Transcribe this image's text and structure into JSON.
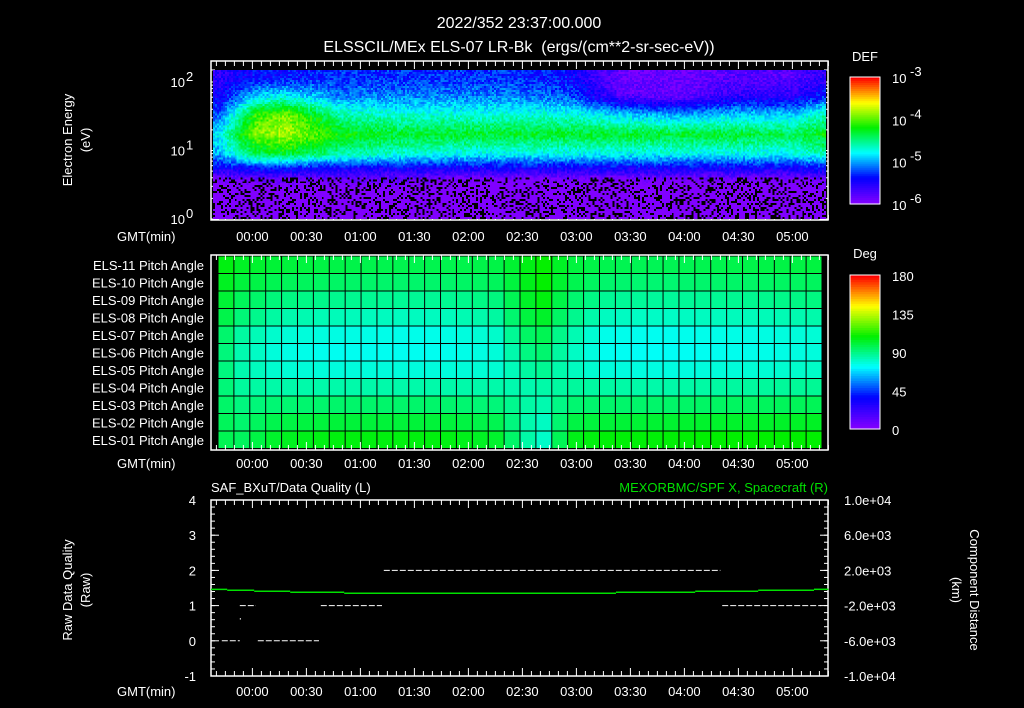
{
  "header": {
    "timestamp": "2022/352 23:37:00.000",
    "subtitle": "ELSSCIL/MEx ELS-07 LR-Bk  (ergs/(cm**2-sr-sec-eV))"
  },
  "colors": {
    "background": "#000000",
    "axis": "#ffffff",
    "spacecraft_line": "#00e000",
    "quality_line": "#ffffff"
  },
  "time_axis": {
    "label": "GMT(min)",
    "start_min": -23,
    "end_min": 320,
    "ticks": [
      {
        "min": 0,
        "label": "00:00"
      },
      {
        "min": 30,
        "label": "00:30"
      },
      {
        "min": 60,
        "label": "01:00"
      },
      {
        "min": 90,
        "label": "01:30"
      },
      {
        "min": 120,
        "label": "02:00"
      },
      {
        "min": 150,
        "label": "02:30"
      },
      {
        "min": 180,
        "label": "03:00"
      },
      {
        "min": 210,
        "label": "03:30"
      },
      {
        "min": 240,
        "label": "04:00"
      },
      {
        "min": 270,
        "label": "04:30"
      },
      {
        "min": 300,
        "label": "05:00"
      }
    ]
  },
  "chart_data": [
    {
      "type": "heatmap",
      "title": "ELSSCIL/MEx ELS-07 LR-Bk",
      "ylabel": "Electron Energy",
      "yunits": "(eV)",
      "yscale": "log",
      "ylim": [
        1,
        200
      ],
      "yticks": [
        {
          "value": 1,
          "base": "10",
          "exp": "0"
        },
        {
          "value": 10,
          "base": "10",
          "exp": "1"
        },
        {
          "value": 100,
          "base": "10",
          "exp": "2"
        }
      ],
      "colorbar": {
        "label": "DEF",
        "scale": "log",
        "range": [
          1e-06,
          0.001
        ],
        "ticks": [
          {
            "base": "10",
            "exp": "-3"
          },
          {
            "base": "10",
            "exp": "-4"
          },
          {
            "base": "10",
            "exp": "-5"
          },
          {
            "base": "10",
            "exp": "-6"
          }
        ]
      },
      "times_min": [
        -20,
        0,
        15,
        45,
        75,
        105,
        135,
        165,
        195,
        225,
        255,
        285,
        305,
        318
      ],
      "energies_eV": [
        1.5,
        2.5,
        4,
        6,
        10,
        20,
        40,
        80,
        150
      ],
      "log10_def": [
        [
          -6.3,
          -6.3,
          -6.3,
          -6.3,
          -6.3,
          -6.4,
          -6.4,
          -6.4,
          -6.4,
          -6.4,
          -6.4,
          -6.4,
          -6.3,
          -6.2
        ],
        [
          -6.2,
          -6.2,
          -6.2,
          -6.2,
          -6.2,
          -6.3,
          -6.3,
          -6.3,
          -6.3,
          -6.3,
          -6.3,
          -6.3,
          -6.2,
          -6.1
        ],
        [
          -6.0,
          -5.9,
          -5.9,
          -5.9,
          -5.9,
          -6.0,
          -6.0,
          -6.0,
          -6.0,
          -6.0,
          -6.0,
          -6.0,
          -5.9,
          -5.8
        ],
        [
          -5.5,
          -5.4,
          -5.4,
          -5.5,
          -5.5,
          -5.5,
          -5.5,
          -5.5,
          -5.5,
          -5.5,
          -5.5,
          -5.5,
          -5.4,
          -5.2
        ],
        [
          -5.0,
          -4.4,
          -4.3,
          -4.6,
          -4.7,
          -4.8,
          -4.8,
          -4.8,
          -4.8,
          -4.8,
          -4.8,
          -4.8,
          -4.6,
          -4.2
        ],
        [
          -4.8,
          -3.9,
          -3.8,
          -4.2,
          -4.3,
          -4.3,
          -4.3,
          -4.3,
          -4.3,
          -4.3,
          -4.3,
          -4.4,
          -4.2,
          -3.6
        ],
        [
          -5.2,
          -4.1,
          -3.9,
          -4.6,
          -4.7,
          -4.7,
          -4.7,
          -4.7,
          -4.9,
          -5.0,
          -4.9,
          -4.9,
          -4.6,
          -3.6
        ],
        [
          -5.5,
          -4.9,
          -4.8,
          -5.1,
          -5.1,
          -5.1,
          -5.1,
          -5.2,
          -5.8,
          -5.9,
          -5.6,
          -5.6,
          -5.3,
          -4.4
        ],
        [
          -5.6,
          -5.4,
          -5.4,
          -5.3,
          -5.3,
          -5.3,
          -5.3,
          -5.4,
          -5.9,
          -5.9,
          -5.8,
          -5.8,
          -5.6,
          -5.0
        ]
      ]
    },
    {
      "type": "heatmap",
      "title": "Pitch Angle",
      "colorbar": {
        "label": "Deg",
        "range": [
          0,
          180
        ],
        "ticks": [
          "180",
          "135",
          "90",
          "45",
          "0"
        ]
      },
      "times_min": [
        -20,
        -8,
        15,
        45,
        75,
        105,
        135,
        150,
        160,
        175,
        195,
        225,
        255,
        285,
        315
      ],
      "rows": [
        {
          "label": "ELS-11 Pitch Angle",
          "values": [
            108,
            103,
            100,
            98,
            97,
            97,
            98,
            103,
            110,
            100,
            97,
            96,
            97,
            98,
            99
          ]
        },
        {
          "label": "ELS-10 Pitch Angle",
          "values": [
            106,
            100,
            96,
            94,
            93,
            93,
            95,
            102,
            110,
            98,
            93,
            92,
            93,
            94,
            95
          ]
        },
        {
          "label": "ELS-09 Pitch Angle",
          "values": [
            104,
            96,
            90,
            88,
            87,
            87,
            90,
            100,
            108,
            94,
            87,
            86,
            87,
            88,
            90
          ]
        },
        {
          "label": "ELS-08 Pitch Angle",
          "values": [
            102,
            92,
            84,
            82,
            81,
            81,
            85,
            97,
            104,
            90,
            81,
            80,
            81,
            82,
            84
          ]
        },
        {
          "label": "ELS-07 Pitch Angle",
          "values": [
            98,
            86,
            78,
            76,
            75,
            75,
            79,
            92,
            98,
            85,
            75,
            74,
            75,
            76,
            78
          ]
        },
        {
          "label": "ELS-06 Pitch Angle",
          "values": [
            96,
            84,
            76,
            74,
            74,
            74,
            77,
            88,
            94,
            82,
            74,
            73,
            74,
            75,
            77
          ]
        },
        {
          "label": "ELS-05 Pitch Angle",
          "values": [
            95,
            84,
            78,
            77,
            77,
            77,
            78,
            84,
            88,
            82,
            77,
            76,
            77,
            78,
            80
          ]
        },
        {
          "label": "ELS-04 Pitch Angle",
          "values": [
            95,
            86,
            84,
            84,
            84,
            84,
            84,
            83,
            84,
            86,
            85,
            84,
            85,
            86,
            87
          ]
        },
        {
          "label": "ELS-03 Pitch Angle",
          "values": [
            96,
            90,
            92,
            93,
            93,
            93,
            91,
            86,
            82,
            92,
            93,
            93,
            94,
            95,
            96
          ]
        },
        {
          "label": "ELS-02 Pitch Angle",
          "values": [
            98,
            92,
            98,
            100,
            100,
            100,
            97,
            86,
            78,
            98,
            100,
            101,
            102,
            102,
            103
          ]
        },
        {
          "label": "ELS-01 Pitch Angle",
          "values": [
            98,
            94,
            103,
            106,
            106,
            106,
            102,
            88,
            76,
            104,
            107,
            107,
            108,
            108,
            108
          ]
        }
      ]
    },
    {
      "type": "line",
      "title_left": "SAF_BXuT/Data Quality (L)",
      "title_right": "MEXORBMC/SPF X, Spacecraft (R)",
      "ylabel_left": "Raw Data Quality",
      "yunits_left": "(Raw)",
      "ylabel_right": "Component Distance",
      "yunits_right": "(km)",
      "ylim_left": [
        -1,
        4
      ],
      "yticks_left": [
        "4",
        "3",
        "2",
        "1",
        "0",
        "-1"
      ],
      "ylim_right": [
        -10000,
        10000
      ],
      "yticks_right": [
        "1.0e+04",
        "6.0e+03",
        "2.0e+03",
        "-2.0e+03",
        "-6.0e+03",
        "-1.0e+04"
      ],
      "quality_segments": [
        {
          "t0": -17,
          "t1": -7,
          "value": 0
        },
        {
          "t0": 3,
          "t1": 37,
          "value": 0
        },
        {
          "t0": -7,
          "t1": 2,
          "value": 1
        },
        {
          "t0": 38,
          "t1": 72,
          "value": 1
        },
        {
          "t0": 73,
          "t1": 260,
          "value": 2
        },
        {
          "t0": 261,
          "t1": 316,
          "value": 1
        }
      ],
      "quality_points": [
        {
          "t": -7,
          "value": 0.64
        }
      ],
      "spacecraft_x_km": [
        {
          "t0": -23,
          "t1": -14,
          "value": -150
        },
        {
          "t0": -14,
          "t1": 1,
          "value": -260
        },
        {
          "t0": 1,
          "t1": 21,
          "value": -375
        },
        {
          "t0": 21,
          "t1": 51,
          "value": -490
        },
        {
          "t0": 51,
          "t1": 202,
          "value": -600
        },
        {
          "t0": 202,
          "t1": 246,
          "value": -490
        },
        {
          "t0": 246,
          "t1": 281,
          "value": -375
        },
        {
          "t0": 281,
          "t1": 312,
          "value": -260
        },
        {
          "t0": 312,
          "t1": 320,
          "value": -150
        }
      ]
    }
  ]
}
